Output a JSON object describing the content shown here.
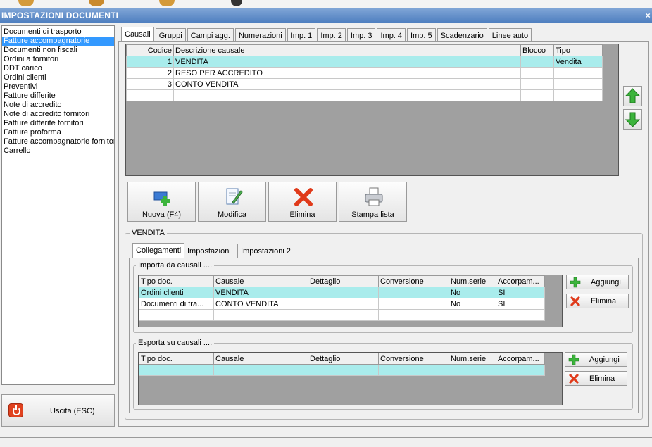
{
  "window": {
    "title": "IMPOSTAZIONI DOCUMENTI",
    "close": "×"
  },
  "doc_types": [
    "Documenti di trasporto",
    "Fatture accompagnatorie",
    "Documenti non fiscali",
    "Ordini a fornitori",
    "DDT carico",
    "Ordini clienti",
    "Preventivi",
    "Fatture differite",
    "Note di accredito",
    "Note di accredito fornitori",
    "Fatture differite fornitori",
    "Fatture proforma",
    "Fatture accompagnatorie fornitori",
    "Carrello"
  ],
  "selected_doc_type": "Fatture accompagnatorie",
  "exit_label": "Uscita (ESC)",
  "tabs": [
    "Causali",
    "Gruppi",
    "Campi agg.",
    "Numerazioni",
    "Imp. 1",
    "Imp. 2",
    "Imp. 3",
    "Imp. 4",
    "Imp. 5",
    "Scadenzario",
    "Linee auto"
  ],
  "active_tab": "Causali",
  "causali": {
    "headers": [
      "Codice",
      "Descrizione causale",
      "Blocco",
      "Tipo"
    ],
    "rows": [
      [
        "1",
        "VENDITA",
        "",
        "Vendita"
      ],
      [
        "2",
        "RESO PER ACCREDITO",
        "",
        ""
      ],
      [
        "3",
        "CONTO VENDITA",
        "",
        ""
      ]
    ]
  },
  "actions": {
    "new": "Nuova (F4)",
    "edit": "Modifica",
    "delete": "Elimina",
    "print": "Stampa lista"
  },
  "detail": {
    "title": "VENDITA",
    "subtabs": [
      "Collegamenti",
      "Impostazioni",
      "Impostazioni 2"
    ],
    "import_title": "Importa da causali ....",
    "export_title": "Esporta su causali ....",
    "link_headers": [
      "Tipo doc.",
      "Causale",
      "Dettaglio",
      "Conversione",
      "Num.serie",
      "Accorpam..."
    ],
    "import_rows": [
      [
        "Ordini clienti",
        "VENDITA",
        "",
        "",
        "No",
        "SI"
      ],
      [
        "Documenti di tra...",
        "CONTO VENDITA",
        "",
        "",
        "No",
        "SI"
      ]
    ],
    "add_label": "Aggiungi",
    "remove_label": "Elimina"
  },
  "colors": {
    "title_bar": "#4f7fc0",
    "selection": "#3399ff",
    "row_highlight": "#a9ecec"
  }
}
